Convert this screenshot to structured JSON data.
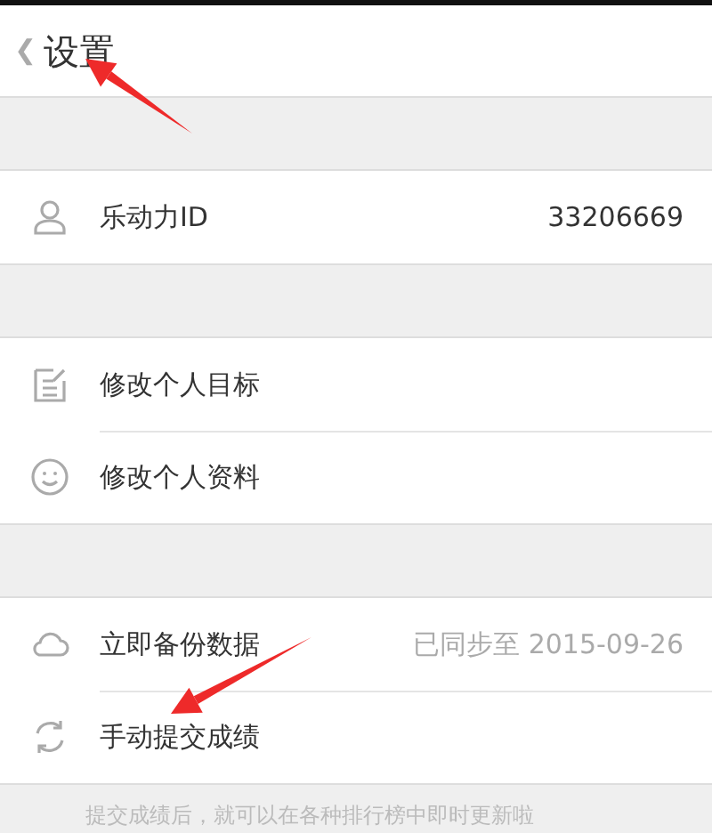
{
  "header": {
    "back": "❮",
    "title": "设置"
  },
  "sections": [
    {
      "items": [
        {
          "kind": "person",
          "label": "乐动力ID",
          "value": "33206669"
        }
      ]
    },
    {
      "items": [
        {
          "kind": "note",
          "label": "修改个人目标"
        },
        {
          "kind": "smile",
          "label": "修改个人资料"
        }
      ]
    },
    {
      "items": [
        {
          "kind": "cloud",
          "label": "立即备份数据",
          "value": "已同步至 2015-09-26"
        },
        {
          "kind": "sync",
          "label": "手动提交成绩"
        }
      ]
    }
  ],
  "footer_note": "提交成绩后，就可以在各种排行榜中即时更新啦",
  "annotations": [
    {
      "kind": "arrow"
    },
    {
      "kind": "arrow"
    }
  ]
}
